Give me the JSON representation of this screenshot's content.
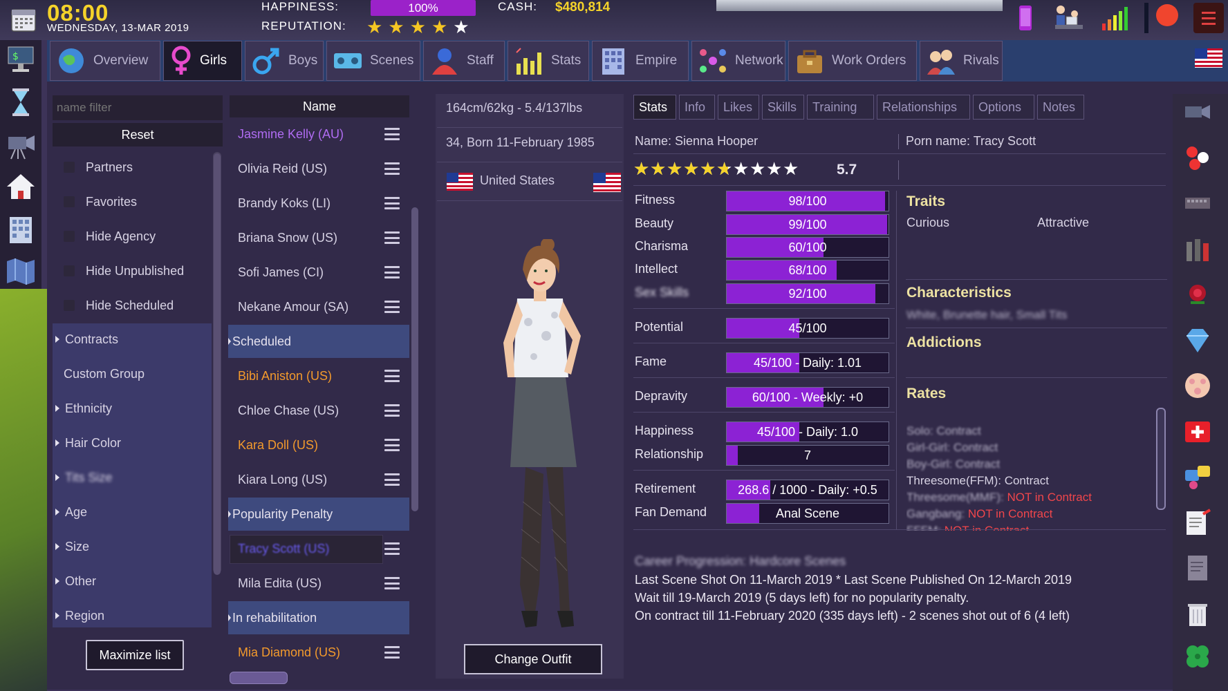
{
  "header": {
    "time": "08:00",
    "date": "WEDNESDAY, 13-MAR 2019",
    "happiness_label": "HAPPINESS:",
    "happiness_value": "100%",
    "cash_label": "CASH:",
    "cash_value": "$480,814",
    "reputation_label": "REPUTATION:",
    "reputation_stars": 4,
    "reputation_max": 5
  },
  "tabs": [
    {
      "label": "Overview"
    },
    {
      "label": "Girls"
    },
    {
      "label": "Boys"
    },
    {
      "label": "Scenes"
    },
    {
      "label": "Staff"
    },
    {
      "label": "Stats"
    },
    {
      "label": "Empire"
    },
    {
      "label": "Network"
    },
    {
      "label": "Work Orders"
    },
    {
      "label": "Rivals"
    }
  ],
  "filters": {
    "name_placeholder": "name filter",
    "reset_label": "Reset",
    "checkboxes": [
      "Partners",
      "Favorites",
      "Hide Agency",
      "Hide Unpublished",
      "Hide Scheduled"
    ],
    "groups": [
      "Contracts",
      "Custom Group",
      "Ethnicity",
      "Hair Color",
      "Tits Size",
      "Age",
      "Size",
      "Other",
      "Region"
    ],
    "maximize_label": "Maximize list"
  },
  "name_list": {
    "header": "Name",
    "rows": [
      {
        "type": "name",
        "text": "Jasmine Kelly  (AU)",
        "color": "#b06cf2"
      },
      {
        "type": "name",
        "text": "Olivia Reid  (US)",
        "color": "#d7d2e4"
      },
      {
        "type": "name",
        "text": "Brandy Koks  (LI)",
        "color": "#d7d2e4"
      },
      {
        "type": "name",
        "text": "Briana Snow  (US)",
        "color": "#d7d2e4"
      },
      {
        "type": "name",
        "text": "Sofi James  (CI)",
        "color": "#d7d2e4"
      },
      {
        "type": "name",
        "text": "Nekane Amour  (SA)",
        "color": "#d7d2e4"
      },
      {
        "type": "section",
        "text": "Scheduled"
      },
      {
        "type": "name",
        "text": "Bibi Aniston  (US)",
        "color": "#f39a2c"
      },
      {
        "type": "name",
        "text": "Chloe Chase  (US)",
        "color": "#d7d2e4"
      },
      {
        "type": "name",
        "text": "Kara Doll  (US)",
        "color": "#f39a2c"
      },
      {
        "type": "name",
        "text": "Kiara Long  (US)",
        "color": "#d7d2e4"
      },
      {
        "type": "section",
        "text": "Popularity Penalty"
      },
      {
        "type": "name",
        "text": "Tracy Scott  (US)",
        "color": "#6a5cf2",
        "selected": true
      },
      {
        "type": "name",
        "text": "Mila Edita  (US)",
        "color": "#d7d2e4"
      },
      {
        "type": "section",
        "text": "In rehabilitation"
      },
      {
        "type": "name",
        "text": "Mia Diamond  (US)",
        "color": "#f39a2c"
      }
    ]
  },
  "profile": {
    "measurements": "164cm/62kg - 5.4/137lbs",
    "age_birth": "34, Born 11-February 1985",
    "country": "United States",
    "change_outfit_label": "Change Outfit"
  },
  "detail_tabs": [
    "Stats",
    "Info",
    "Likes",
    "Skills",
    "Training",
    "Relationships",
    "Options",
    "Notes"
  ],
  "identity": {
    "name": "Name: Sienna Hooper",
    "porn_name": "Porn name: Tracy Scott",
    "rating": "5.7",
    "rating_stars_filled": 5.7,
    "rating_stars_total": 10
  },
  "stats": [
    {
      "label": "Fitness",
      "text": "98/100",
      "value": 98
    },
    {
      "label": "Beauty",
      "text": "99/100",
      "value": 99
    },
    {
      "label": "Charisma",
      "text": "60/100",
      "value": 60
    },
    {
      "label": "Intellect",
      "text": "68/100",
      "value": 68
    },
    {
      "label": "Sex Skills",
      "text": "92/100",
      "value": 92
    },
    {
      "label": "Potential",
      "text": "45/100",
      "value": 45
    },
    {
      "label": "Fame",
      "text": "45/100 - Daily: 1.01",
      "value": 45
    },
    {
      "label": "Depravity",
      "text": "60/100 - Weekly: +0",
      "value": 60
    },
    {
      "label": "Happiness",
      "text": "45/100 - Daily: 1.0",
      "value": 45
    },
    {
      "label": "Relationship",
      "text": "7",
      "value": 7
    },
    {
      "label": "Retirement",
      "text": "268.6 / 1000 - Daily: +0.5",
      "value": 26.86
    },
    {
      "label": "Fan Demand",
      "text": "Anal Scene",
      "value": 20
    }
  ],
  "traits": {
    "title": "Traits",
    "items": [
      "Curious",
      "Attractive"
    ],
    "characteristics_title": "Characteristics",
    "characteristics": "White, Brunette hair, Small Tits",
    "addictions_title": "Addictions",
    "rates_title": "Rates",
    "rates": [
      {
        "name": "Solo: ",
        "status": "Contract"
      },
      {
        "name": "Girl-Girl: ",
        "status": "Contract"
      },
      {
        "name": "Boy-Girl: ",
        "status": "Contract"
      },
      {
        "name": "Threesome(FFM): ",
        "status": "Contract"
      },
      {
        "name": "Threesome(MMF): ",
        "status": "NOT in Contract"
      },
      {
        "name": "Gangbang: ",
        "status": "NOT in Contract"
      },
      {
        "name": "FFFM: ",
        "status": "NOT in Contract"
      }
    ]
  },
  "career": {
    "progression": "Career Progression: Hardcore Scenes",
    "last_scene": "Last Scene Shot On 11-March 2019 * Last Scene Published On 12-March 2019",
    "wait": "Wait till 19-March 2019 (5 days left) for no popularity penalty.",
    "contract": "On contract till 11-February 2020 (335 days left) - 2 scenes shot out of 6 (4 left)"
  },
  "colors": {
    "accent_purple": "#8c22d4",
    "heading_yellow": "#ede2a2",
    "time_yellow": "#f5d32a"
  }
}
